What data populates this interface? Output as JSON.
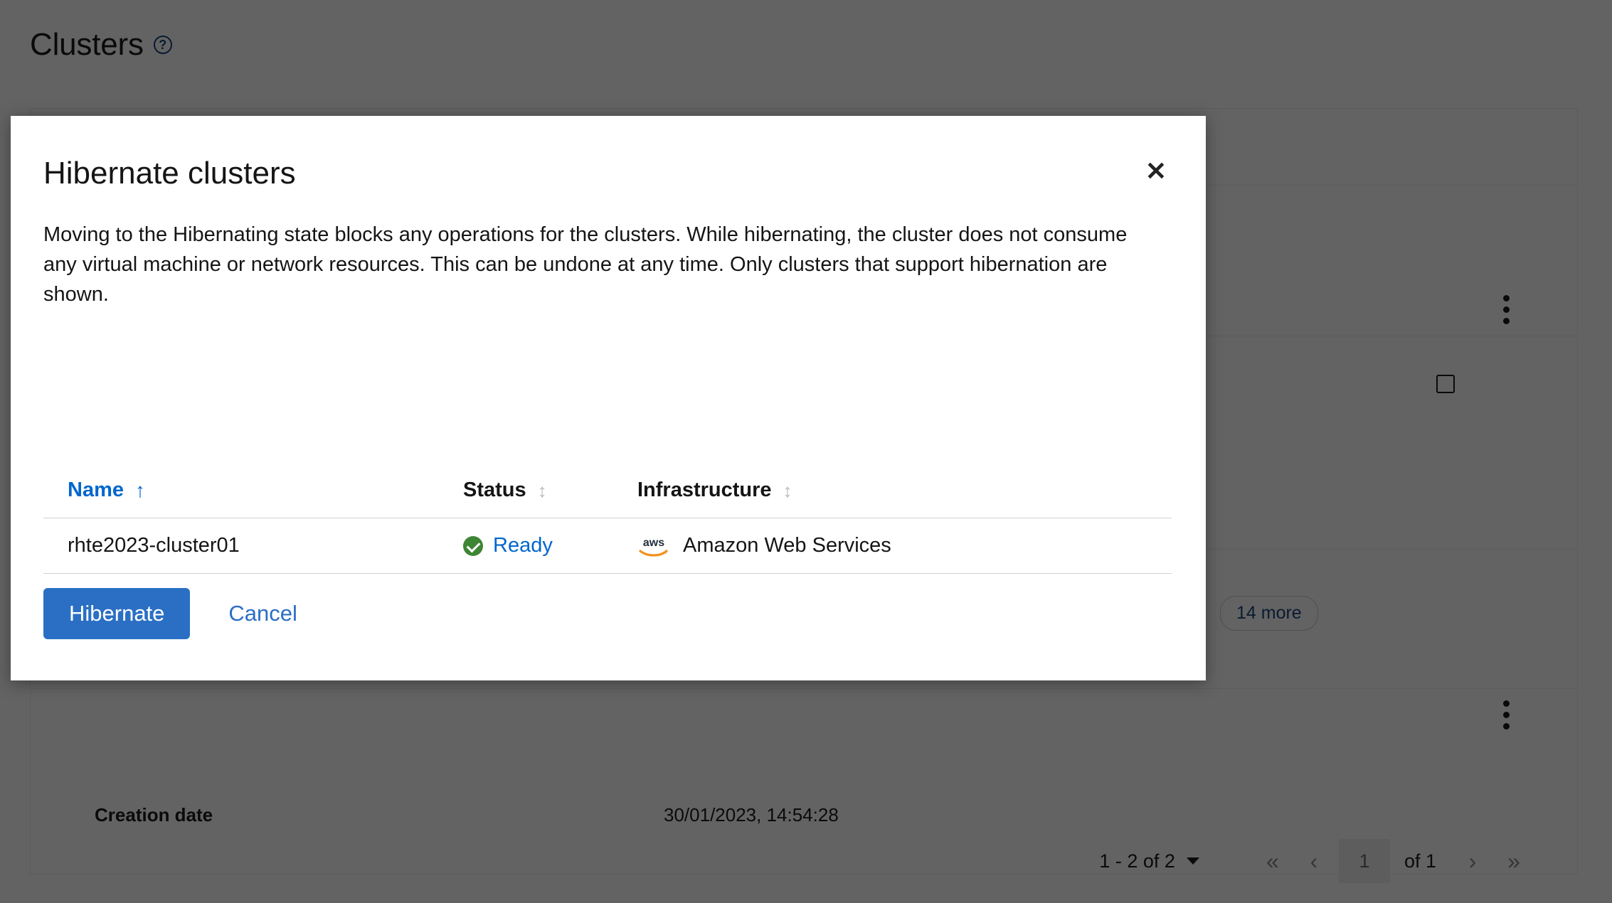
{
  "page": {
    "title": "Clusters",
    "help_icon": "help-circle-icon"
  },
  "background": {
    "detail_label": "Creation date",
    "detail_value": "30/01/2023, 14:54:28",
    "more_chip": "14 more",
    "kebab_icon": "kebab-menu-icon",
    "checkbox_icon": "checkbox-unchecked-icon",
    "pagination": {
      "range": "1 - 2 of 2",
      "caret_icon": "chevron-down-icon",
      "first_icon": "«",
      "prev_icon": "‹",
      "page_value": "1",
      "of_total": "of 1",
      "next_icon": "›",
      "last_icon": "»"
    }
  },
  "modal": {
    "title": "Hibernate clusters",
    "close_icon": "close-x-icon",
    "body": "Moving to the Hibernating state blocks any operations for the clusters. While hibernating, the cluster does not consume any virtual machine or network resources. This can be undone at any time. Only clusters that support hibernation are shown.",
    "table": {
      "columns": [
        {
          "label": "Name",
          "sort": "asc",
          "sort_icon": "arrow-up-icon"
        },
        {
          "label": "Status",
          "sort": "none",
          "sort_icon": "sort-updown-icon"
        },
        {
          "label": "Infrastructure",
          "sort": "none",
          "sort_icon": "sort-updown-icon"
        }
      ],
      "rows": [
        {
          "name": "rhte2023-cluster01",
          "status": "Ready",
          "status_icon": "check-circle-icon",
          "infrastructure": "Amazon Web Services",
          "infrastructure_icon": "aws-logo-icon"
        }
      ]
    },
    "actions": {
      "confirm": "Hibernate",
      "cancel": "Cancel"
    }
  },
  "colors": {
    "primary_blue": "#2a6fc4",
    "link_blue": "#0066cc",
    "status_green": "#3e8635",
    "aws_orange": "#f2921d",
    "aws_navy": "#252f3e",
    "scrim": "rgba(3,3,3,0.62)"
  }
}
